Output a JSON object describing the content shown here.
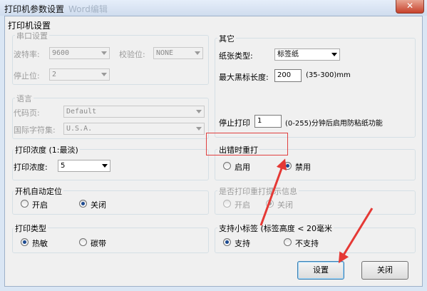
{
  "window": {
    "title": "打印机参数设置",
    "ghost_title": "Word编辑",
    "close_glyph": "✕"
  },
  "main_group": "打印机设置",
  "serial": {
    "group": "串口设置",
    "baud_label": "波特率:",
    "baud_value": "9600",
    "parity_label": "校验位:",
    "parity_value": "NONE",
    "stop_label": "停止位:",
    "stop_value": "2"
  },
  "language": {
    "group": "语言",
    "codepage_label": "代码页:",
    "codepage_value": "Default",
    "intl_label": "国际字符集:",
    "intl_value": "U.S.A."
  },
  "other": {
    "group": "其它",
    "paper_label": "纸张类型:",
    "paper_value": "标签纸",
    "max_black_label": "最大黑标长度:",
    "max_black_value": "200",
    "max_black_range": "(35-300)mm",
    "stop_print_label": "停止打印",
    "stop_print_value": "1",
    "stop_print_note": "(0-255)分钟后启用防粘纸功能"
  },
  "density": {
    "group": "打印浓度 (1:最淡)",
    "label": "打印浓度:",
    "value": "5"
  },
  "reprint_on_error": {
    "group": "出错时重打",
    "enable": "启用",
    "disable": "禁用"
  },
  "auto_position": {
    "group": "开机自动定位",
    "on": "开启",
    "off": "关闭"
  },
  "reprint_info": {
    "group": "是否打印重打提示信息",
    "on": "开启",
    "off": "关闭"
  },
  "print_type": {
    "group": "打印类型",
    "thermal": "热敏",
    "ribbon": "碳带"
  },
  "small_label": {
    "group": "支持小标签 (标签高度 < 20毫米",
    "support": "支持",
    "no_support": "不支持"
  },
  "buttons": {
    "set": "设置",
    "close": "关闭"
  },
  "colors": {
    "annotation_red": "#e53935",
    "title_bar": "#dae6f4"
  }
}
